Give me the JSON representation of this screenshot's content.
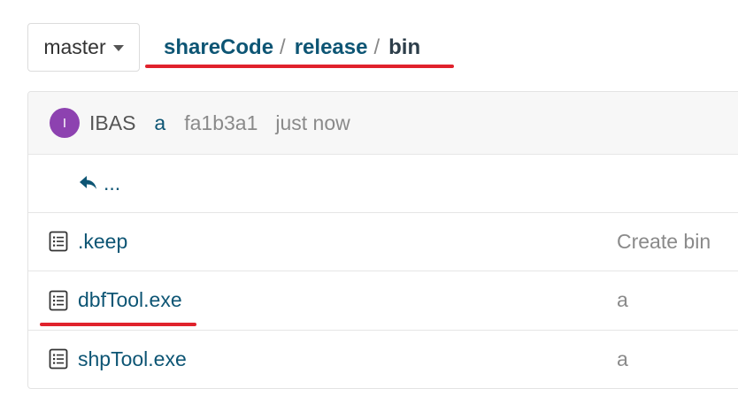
{
  "branch": {
    "label": "master",
    "icon": "caret-down-icon"
  },
  "breadcrumb": {
    "items": [
      "shareCode",
      "release",
      "bin"
    ],
    "separator": "/"
  },
  "commit": {
    "avatar_letter": "I",
    "avatar_color": "#8d42b0",
    "author": "IBAS",
    "message": "a",
    "sha": "fa1b3a1",
    "time": "just now"
  },
  "parent_dir": {
    "label": "...",
    "icon": "reply-arrow-icon"
  },
  "files": [
    {
      "name": ".keep",
      "commit_message": "Create bin",
      "icon": "file-icon"
    },
    {
      "name": "dbfTool.exe",
      "commit_message": "a",
      "icon": "file-icon"
    },
    {
      "name": "shpTool.exe",
      "commit_message": "a",
      "icon": "file-icon"
    }
  ],
  "colors": {
    "link": "#0d5574",
    "muted": "#8a8a8a",
    "annotation_red": "#e0222c"
  }
}
